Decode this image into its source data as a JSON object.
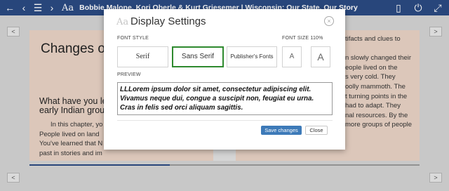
{
  "toolbar": {
    "back_icon": "arrow-left-icon",
    "prev_icon": "chevron-left-icon",
    "toc_icon": "list-icon",
    "next_icon": "chevron-right-icon",
    "font_label": "Aa",
    "book_title": "Bobbie Malone, Kori Oberle & Kurt Griesemer | Wisconsin: Our State, Our Story",
    "book_icon": "book-icon",
    "power_icon": "power-icon",
    "fullscreen_icon": "fullscreen-icon",
    "color": "#2b4a82"
  },
  "reader": {
    "prev_page": "<",
    "next_page": ">",
    "left_page": {
      "chapter_title": "Changes ov",
      "sub_heading_line1": "What have you lea",
      "sub_heading_line2": "early Indian group",
      "paragraph_lines": [
        "In this chapter, yo",
        "People lived on land",
        "You've learned that N",
        "past in stories and im"
      ]
    },
    "right_page": {
      "lines": [
        "tifacts and clues to",
        "",
        "n slowly changed their",
        "eople lived on the",
        "s very cold. They",
        "oolly mammoth. The",
        "t turning points in the",
        "had to adapt. They",
        "nal resources. By the",
        "more groups of people"
      ]
    },
    "progress": 0.36
  },
  "dialog": {
    "title_icon": "Aa",
    "title": "Display Settings",
    "close_icon": "×",
    "font_style_label": "FONT STYLE",
    "font_size_label": "FONT SIZE 110%",
    "font_serif": "Serif",
    "font_sans": "Sans Serif",
    "font_publisher": "Publisher's Fonts",
    "size_small": "A",
    "size_large": "A",
    "selected_font": "Sans Serif",
    "preview_label": "PREVIEW",
    "preview_text": "LLLorem ipsum dolor sit amet, consectetur adipiscing elit. Vivamus neque dui, congue a suscipit non, feugiat eu urna. Cras in felis sed orci aliquam sagittis.",
    "save_label": "Save changes",
    "close_label": "Close",
    "accent_selected": "#2f8a2f",
    "accent_save": "#3d7ab8"
  }
}
